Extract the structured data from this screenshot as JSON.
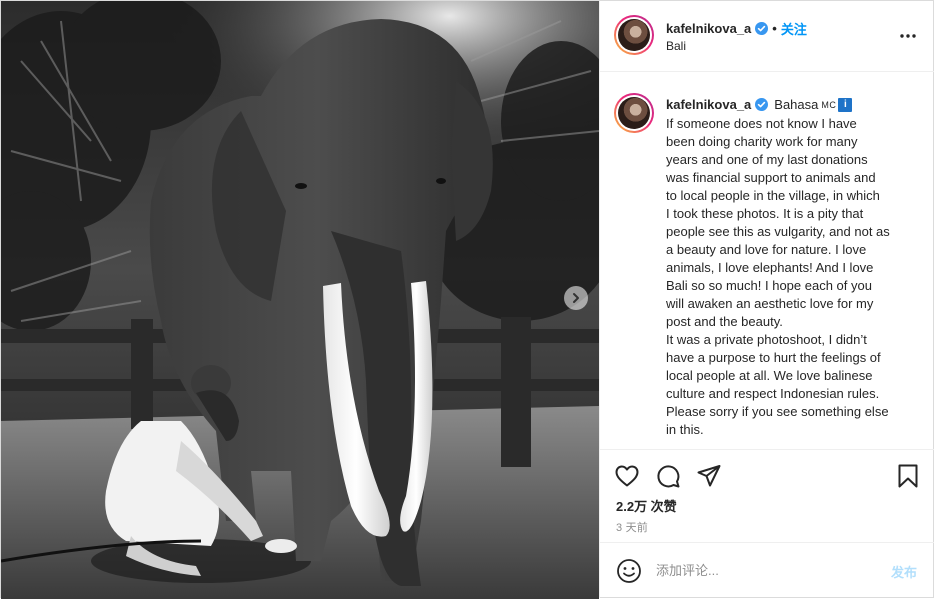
{
  "header": {
    "username": "kafelnikova_a",
    "separator": "•",
    "follow_label": "关注",
    "location": "Bali"
  },
  "caption": {
    "username": "kafelnikova_a",
    "language": "Bahasa",
    "language_code": "MC",
    "info_badge": "i",
    "lines": [
      "If someone does not know I have",
      "been doing charity work for many",
      "years and one of my last donations",
      "was financial support to animals and",
      "to local people in the village, in which",
      "I took these photos. It is a pity that",
      "people see this as vulgarity, and not as",
      "a beauty and love for nature. I love",
      "animals, I love elephants! And I love",
      "Bali so so much! I hope each of you",
      "will awaken an aesthetic love for my",
      "post and the beauty.",
      "It was a private photoshoot, I didn’t",
      "have a purpose to hurt the feelings of",
      "local people at all. We love balinese",
      "culture and respect Indonesian rules.",
      "Please sorry if you see something else",
      "in this."
    ]
  },
  "engagement": {
    "likes": "2.2万 次赞",
    "time_ago": "3 天前"
  },
  "comment": {
    "placeholder": "添加评论...",
    "post_label": "发布"
  },
  "icons": {
    "like": "heart-icon",
    "comment": "comment-icon",
    "share": "send-icon",
    "save": "bookmark-icon",
    "more": "more-options-icon",
    "next": "chevron-right-icon",
    "emoji": "emoji-icon",
    "verified": "verified-badge-icon"
  },
  "colors": {
    "link_blue": "#0095f6",
    "verified_blue": "#3897f0",
    "post_button_disabled": "#b2dffc",
    "muted_text": "#8e8e8e"
  }
}
